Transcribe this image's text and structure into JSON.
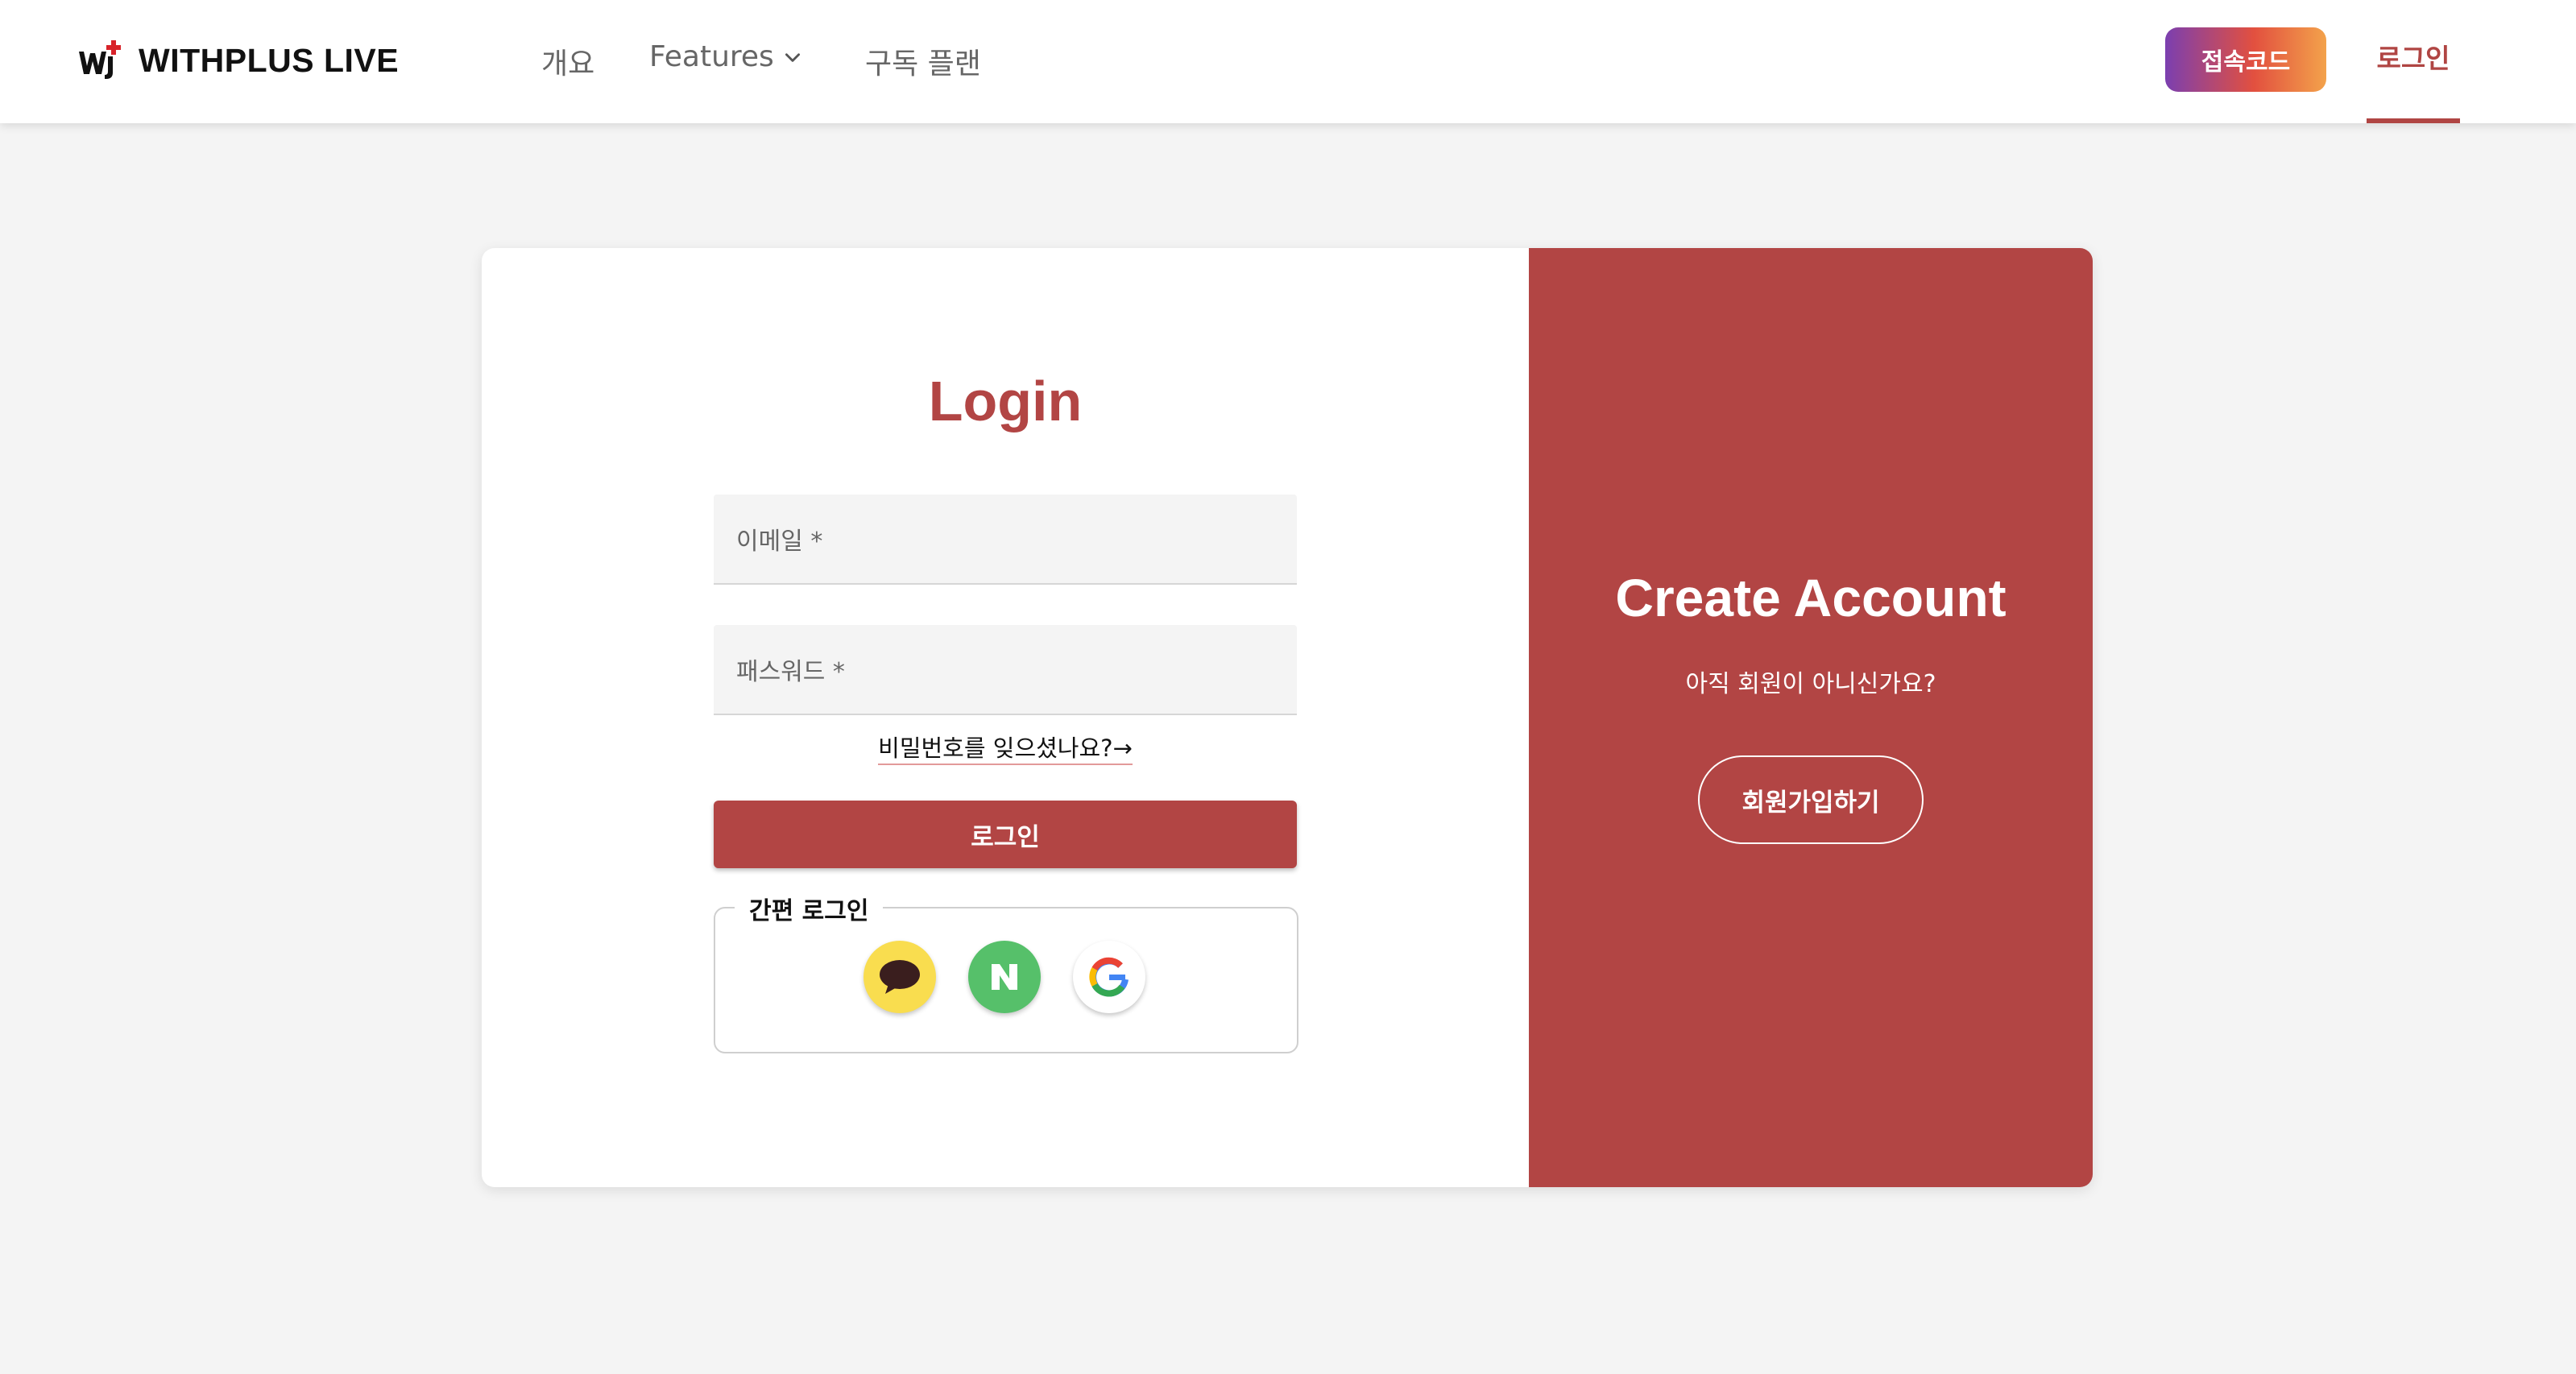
{
  "header": {
    "logo_text": "WITHPLUS LIVE",
    "nav": {
      "overview": "개요",
      "features": "Features",
      "plans": "구독 플랜"
    },
    "access_code_label": "접속코드",
    "login_label": "로그인"
  },
  "login": {
    "title": "Login",
    "email_placeholder": "이메일 *",
    "password_placeholder": "패스워드 *",
    "forgot_password": "비밀번호를 잊으셨나요?→",
    "submit_label": "로그인",
    "social_legend": "간편 로그인",
    "social_providers": [
      "kakao",
      "naver",
      "google"
    ]
  },
  "create_account": {
    "title": "Create Account",
    "subtitle": "아직 회원이 아니신가요?",
    "signup_label": "회원가입하기"
  },
  "colors": {
    "brand": "#b24544",
    "access_gradient": [
      "#7b3fb0",
      "#e2503f",
      "#f3a24b"
    ],
    "kakao": "#f9dd4f",
    "naver": "#56c06a"
  },
  "icons": {
    "logo": "withplus-logo-icon",
    "features_dropdown": "chevron-down-icon",
    "kakao": "kakao-speech-bubble-icon",
    "naver": "naver-n-icon",
    "google": "google-g-icon"
  }
}
